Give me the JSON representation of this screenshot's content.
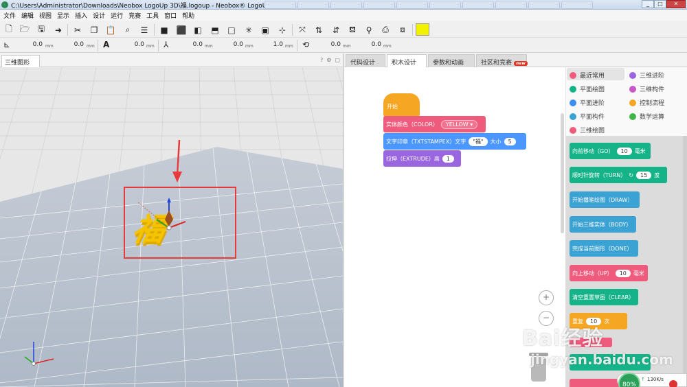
{
  "window": {
    "title": "C:\\Users\\Administrator\\Downloads\\Neobox LogoUp 3D\\福.logoup - Neobox® LogoUp 3D",
    "browser_tabs": [
      "",
      "",
      "",
      "",
      "",
      "",
      "",
      "",
      "",
      "",
      ""
    ],
    "controls": [
      "_",
      "□",
      "✕"
    ]
  },
  "menu": [
    "文件",
    "编辑",
    "视图",
    "显示",
    "插入",
    "设计",
    "运行",
    "竞赛",
    "工具",
    "窗口",
    "帮助"
  ],
  "toolbar1_icons": [
    "new-file-icon",
    "open-folder-icon",
    "save-icon",
    "export-icon",
    "cut-icon",
    "copy-icon",
    "paste-icon",
    "search-icon",
    "indent-icon",
    "cube-solid-icon",
    "cube-front-icon",
    "cube-side-icon",
    "cube-top-icon",
    "cube-outline-icon",
    "cube-exploded-icon",
    "cube-frame-icon",
    "cube-axis-icon",
    "fit-view-icon",
    "move-up-icon",
    "move-down-icon",
    "paint-bucket-icon",
    "pin-icon",
    "camera-icon",
    "box-icon"
  ],
  "toolbar1": {
    "color_swatch": "#f2f200"
  },
  "toolbar2": {
    "position": [
      "0.0",
      "0.0"
    ],
    "rotation_size": [
      "0.0"
    ],
    "scale": [
      "0.0",
      "0.0",
      "1.0"
    ],
    "rotate": [
      "0.0",
      "0.0"
    ],
    "unit": "mm"
  },
  "view_panel": {
    "tab": "三维图形",
    "icons": [
      "?",
      "⚙",
      "▢"
    ],
    "text_shape": "福",
    "text_color": "#f2c200"
  },
  "right_tabs": [
    "代码设计",
    "积木设计",
    "参数和动画",
    "社区和竞赛"
  ],
  "new_badge": "new",
  "categories": [
    {
      "label": "最近常用",
      "color": "#ee5b7d"
    },
    {
      "label": "三维进阶",
      "color": "#9a66e0"
    },
    {
      "label": "平面绘图",
      "color": "#16b389"
    },
    {
      "label": "三维构件",
      "color": "#c758c9"
    },
    {
      "label": "平面进阶",
      "color": "#3b8ff0"
    },
    {
      "label": "控制流程",
      "color": "#f5a623"
    },
    {
      "label": "平面构件",
      "color": "#3ba2d4"
    },
    {
      "label": "数学运算",
      "color": "#3fb447"
    },
    {
      "label": "三维绘图",
      "color": "#ee5b7d"
    }
  ],
  "script": {
    "hat": "开始",
    "color_block": {
      "label": "实体颜色（COLOR）",
      "value": "YELLOW ▾"
    },
    "stamp_block": {
      "label": "文字印章（TXTSTAMPEX）文字",
      "text": "\"福\"",
      "size_label": "大小",
      "size": "5"
    },
    "extrude_block": {
      "label": "拉伸（EXTRUDE）高",
      "value": "1"
    }
  },
  "palette": [
    {
      "label": "向前移动（GO）",
      "value": "10",
      "unit": "毫米",
      "color": "teal"
    },
    {
      "label": "顺时针旋转（TURN）",
      "icon": "↻",
      "value": "15",
      "unit": "度",
      "color": "teal"
    },
    {
      "label": "开始播笔绘图（DRAW）",
      "color": "blue"
    },
    {
      "label": "开始三维实体（BODY）",
      "color": "blue"
    },
    {
      "label": "完成当前图形（DONE）",
      "color": "blue"
    },
    {
      "label": "向上移动（UP）",
      "value": "10",
      "unit": "毫米",
      "color": "pink"
    },
    {
      "label": "清空重置草图（CLEAR）",
      "color": "teal"
    },
    {
      "label": "重复",
      "value": "10",
      "unit": "次",
      "color": "orange"
    }
  ],
  "zoom": {
    "in": "+",
    "out": "−"
  },
  "watermark": {
    "line1": "Bai经验",
    "line2": "jingyan.baidu.com"
  },
  "network": {
    "percent": "80%",
    "speed": "130K/s",
    "arrow": "↑"
  }
}
